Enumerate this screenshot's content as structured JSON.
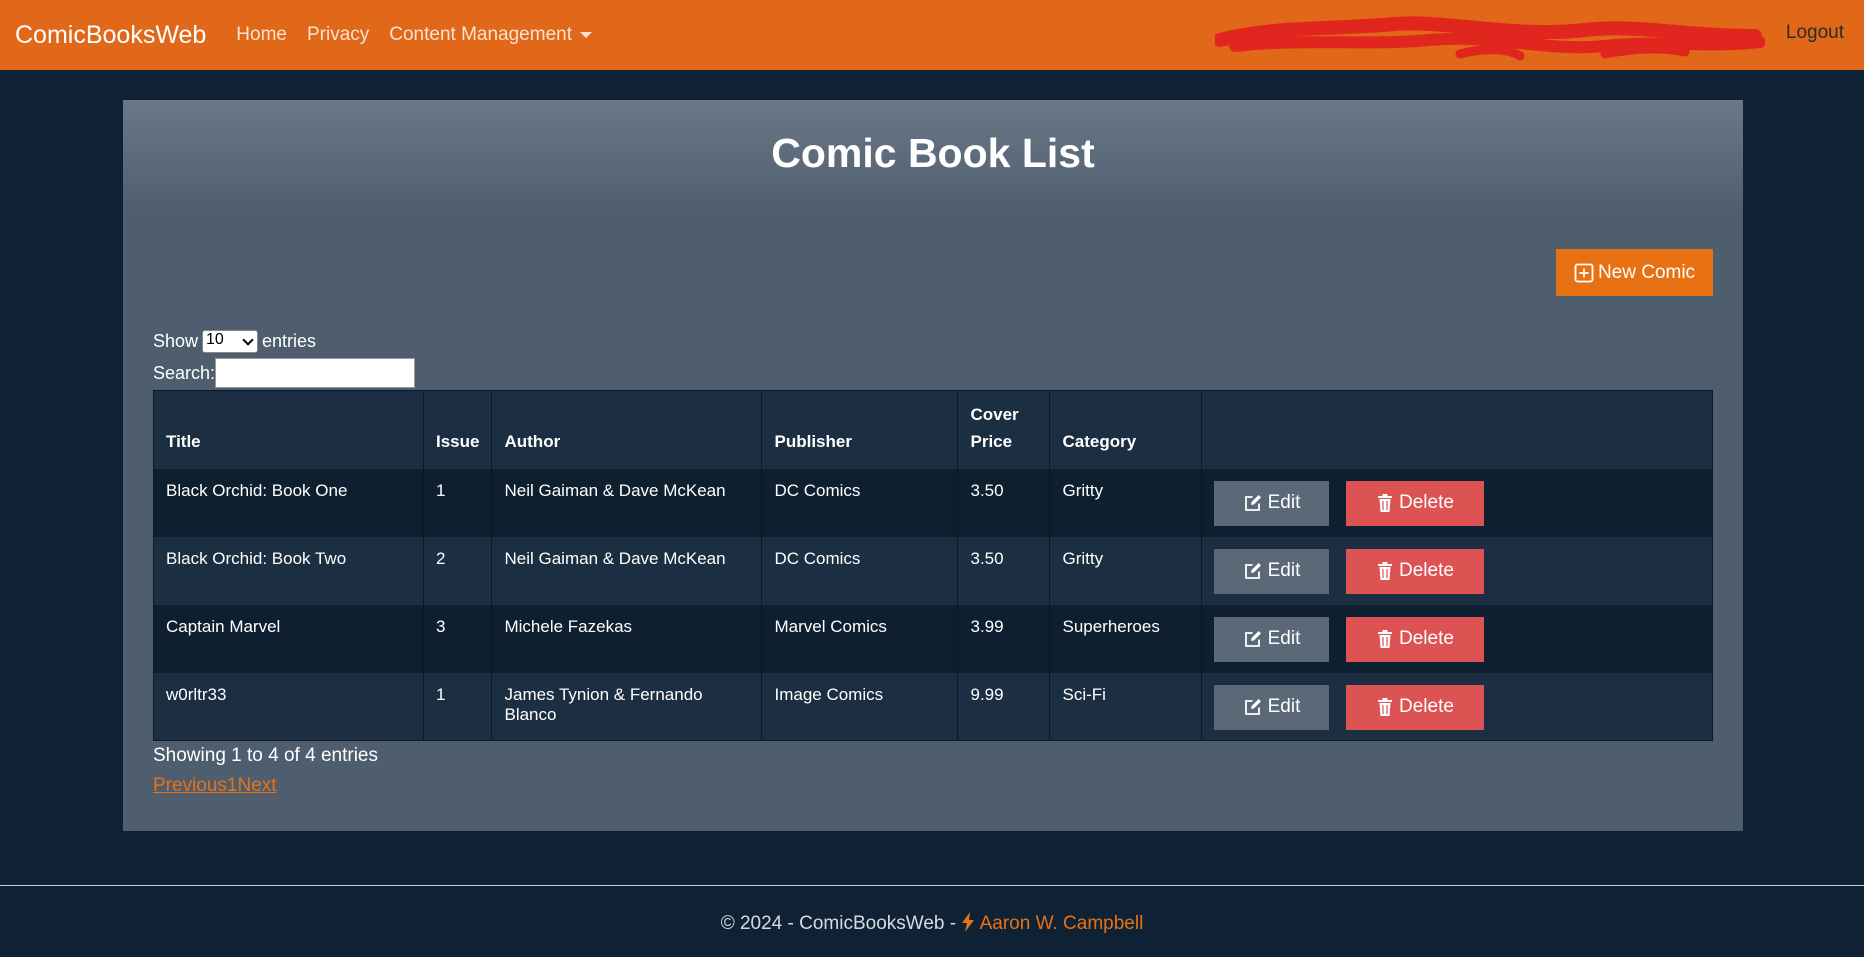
{
  "navbar": {
    "brand": "ComicBooksWeb",
    "links": [
      "Home",
      "Privacy"
    ],
    "dropdown_label": "Content Management",
    "logout": "Logout"
  },
  "page": {
    "title": "Comic Book List",
    "new_button": "New Comic"
  },
  "datatable": {
    "show_prefix": "Show",
    "page_length": "10",
    "show_suffix": "entries",
    "search_label": "Search:",
    "search_value": "",
    "columns": [
      "Title",
      "Issue",
      "Author",
      "Publisher",
      "Cover Price",
      "Category",
      ""
    ],
    "rows": [
      {
        "title": "Black Orchid: Book One",
        "issue": "1",
        "author": "Neil Gaiman & Dave McKean",
        "publisher": "DC Comics",
        "price": "3.50",
        "category": "Gritty"
      },
      {
        "title": "Black Orchid: Book Two",
        "issue": "2",
        "author": "Neil Gaiman & Dave McKean",
        "publisher": "DC Comics",
        "price": "3.50",
        "category": "Gritty"
      },
      {
        "title": "Captain Marvel",
        "issue": "3",
        "author": "Michele Fazekas",
        "publisher": "Marvel Comics",
        "price": "3.99",
        "category": "Superheroes"
      },
      {
        "title": "w0rltr33",
        "issue": "1",
        "author": "James Tynion & Fernando Blanco",
        "publisher": "Image Comics",
        "price": "9.99",
        "category": "Sci-Fi"
      }
    ],
    "edit_label": "Edit",
    "delete_label": "Delete",
    "info": "Showing 1 to 4 of 4 entries",
    "pager": {
      "previous": "Previous",
      "current": "1",
      "next": "Next"
    }
  },
  "footer": {
    "copyright": "© 2024 - ComicBooksWeb -",
    "author": "Aaron W. Campbell"
  },
  "colors": {
    "navbar": "#e06818",
    "accent": "#e87113",
    "background": "#0f2235",
    "delete": "#dd5353",
    "edit": "#5b6877"
  },
  "icons": [
    "plus-square-icon",
    "caret-down-icon",
    "edit-icon",
    "trash-icon",
    "lightning-icon"
  ]
}
